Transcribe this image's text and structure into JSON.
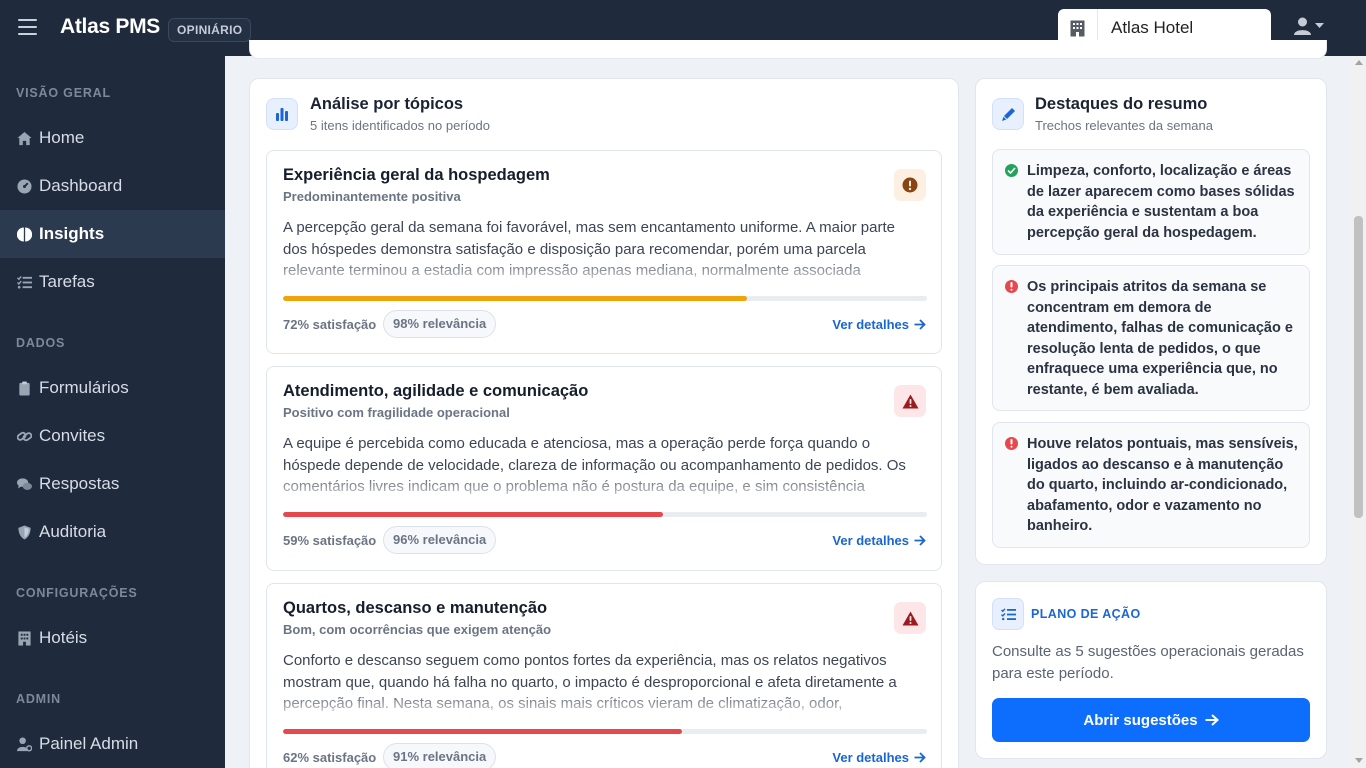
{
  "app": {
    "brand": "Atlas PMS",
    "badge": "OPINIÁRIO"
  },
  "header": {
    "hotel": "Atlas Hotel"
  },
  "sidebar": {
    "sections": [
      "VISÃO GERAL",
      "DADOS",
      "CONFIGURAÇÕES",
      "ADMIN"
    ],
    "items": [
      {
        "label": "Home",
        "icon": "home-icon"
      },
      {
        "label": "Dashboard",
        "icon": "dashboard-icon"
      },
      {
        "label": "Insights",
        "icon": "insights-icon",
        "active": true
      },
      {
        "label": "Tarefas",
        "icon": "tasks-icon"
      },
      {
        "label": "Formulários",
        "icon": "clipboard-icon"
      },
      {
        "label": "Convites",
        "icon": "link-icon"
      },
      {
        "label": "Respostas",
        "icon": "comments-icon"
      },
      {
        "label": "Auditoria",
        "icon": "shield-icon"
      },
      {
        "label": "Hotéis",
        "icon": "building-icon"
      },
      {
        "label": "Painel Admin",
        "icon": "user-cog-icon"
      }
    ]
  },
  "topics": {
    "title": "Análise por tópicos",
    "subtitle": "5 itens identificados no período",
    "items": [
      {
        "title": "Experiência geral da hospedagem",
        "subtitle": "Predominantemente positiva",
        "text": "A percepção geral da semana foi favorável, mas sem encantamento uniforme. A maior parte dos hóspedes demonstra satisfação e disposição para recomendar, porém uma parcela relevante terminou a estadia com impressão apenas mediana, normalmente associada",
        "satisfaction_label": "72% satisfação",
        "satisfaction": 0.72,
        "relevance_label": "98% relevância",
        "link": "Ver detalhes",
        "badge_icon": "exclamation-circle-icon",
        "color": "#f0a30a"
      },
      {
        "title": "Atendimento, agilidade e comunicação",
        "subtitle": "Positivo com fragilidade operacional",
        "text": "A equipe é percebida como educada e atenciosa, mas a operação perde força quando o hóspede depende de velocidade, clareza de informação ou acompanhamento de pedidos. Os comentários livres indicam que o problema não é postura da equipe, e sim consistência",
        "satisfaction_label": "59% satisfação",
        "satisfaction": 0.59,
        "relevance_label": "96% relevância",
        "link": "Ver detalhes",
        "badge_icon": "warning-triangle-icon",
        "color": "#e5484d"
      },
      {
        "title": "Quartos, descanso e manutenção",
        "subtitle": "Bom, com ocorrências que exigem atenção",
        "text": "Conforto e descanso seguem como pontos fortes da experiência, mas os relatos negativos mostram que, quando há falha no quarto, o impacto é desproporcional e afeta diretamente a percepção final. Nesta semana, os sinais mais críticos vieram de climatização, odor,",
        "satisfaction_label": "62% satisfação",
        "satisfaction": 0.62,
        "relevance_label": "91% relevância",
        "link": "Ver detalhes",
        "badge_icon": "warning-triangle-icon",
        "color": "#e5484d"
      }
    ]
  },
  "highlights": {
    "title": "Destaques do resumo",
    "subtitle": "Trechos relevantes da semana",
    "items": [
      {
        "text": "Limpeza, conforto, localização e áreas de lazer aparecem como bases sólidas da experiência e sustentam a boa percepção geral da hospedagem.",
        "status": "positive",
        "color": "#22a35a"
      },
      {
        "text": "Os principais atritos da semana se concentram em demora de atendimento, falhas de comunicação e resolução lenta de pedidos, o que enfraquece uma experiência que, no restante, é bem avaliada.",
        "status": "negative",
        "color": "#e5484d"
      },
      {
        "text": "Houve relatos pontuais, mas sensíveis, ligados ao descanso e à manutenção do quarto, incluindo ar-condicionado, abafamento, odor e vazamento no banheiro.",
        "status": "negative",
        "color": "#e5484d"
      }
    ]
  },
  "plan": {
    "title": "PLANO DE AÇÃO",
    "text": "Consulte as 5 sugestões operacionais geradas para este período.",
    "button": "Abrir sugestões"
  },
  "colors": {
    "accent": "#0d6efd",
    "sidebar": "#1f2a3c",
    "link": "#1a66d2"
  }
}
